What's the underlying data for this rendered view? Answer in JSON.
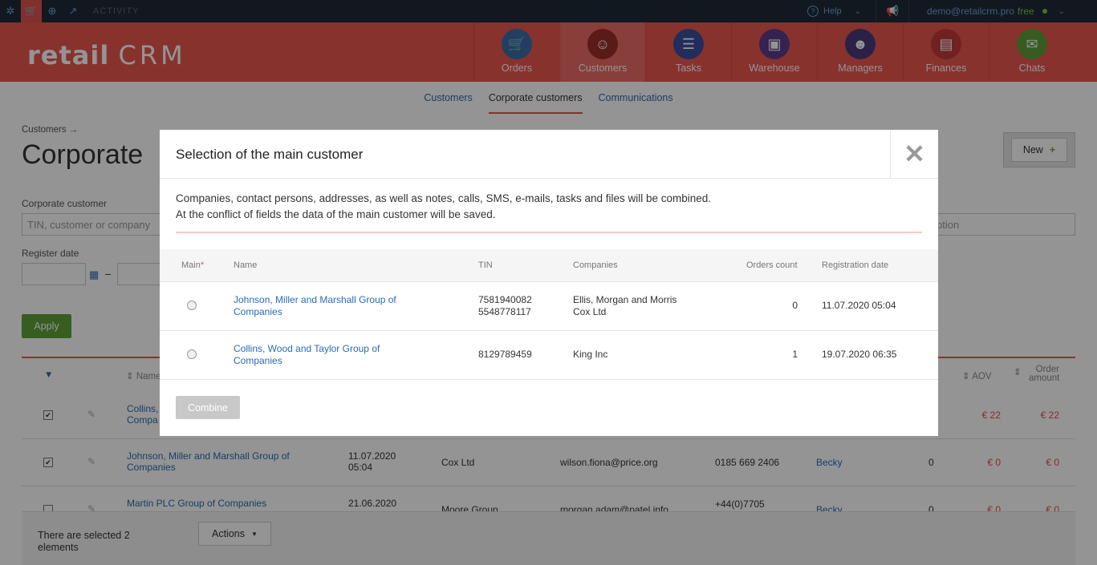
{
  "topbar": {
    "activity": "ACTIVITY",
    "help": "Help",
    "user_email": "demo@retailcrm.pro",
    "plan": "free"
  },
  "header": {
    "logo_text": "retail",
    "logo_text_2": "CRM",
    "nav": [
      {
        "label": "Orders",
        "icon": "cart-icon",
        "color": "#3a6fa8"
      },
      {
        "label": "Customers",
        "icon": "person-icon",
        "color": "#9c2f2a"
      },
      {
        "label": "Tasks",
        "icon": "list-icon",
        "color": "#3b4f9e"
      },
      {
        "label": "Warehouse",
        "icon": "box-icon",
        "color": "#5d3c8a"
      },
      {
        "label": "Managers",
        "icon": "manager-icon",
        "color": "#4a3a7a"
      },
      {
        "label": "Finances",
        "icon": "receipt-icon",
        "color": "#c23c3c"
      },
      {
        "label": "Chats",
        "icon": "chat-icon",
        "color": "#5f9f3a"
      }
    ]
  },
  "subnav": {
    "items": [
      "Customers",
      "Corporate customers",
      "Communications"
    ],
    "active": "Corporate customers"
  },
  "page": {
    "breadcrumb": "Customers →",
    "title": "Corporate",
    "new_button": "New",
    "filter_label_1": "Corporate customer",
    "filter_placeholder_1": "TIN, customer or company",
    "filter_label_2": "Register date",
    "filter_right_placeholder": "ption",
    "date_dash": "–",
    "apply": "Apply"
  },
  "table": {
    "headers": {
      "name": "Name",
      "aov": "AOV",
      "order_amount_1": "Order",
      "order_amount_2": "amount"
    },
    "rows": [
      {
        "name_1": "Collins,",
        "name_2": "Compa",
        "date_1": "",
        "date_2": "",
        "company": "",
        "email": "",
        "phone": "",
        "manager": "",
        "count": "",
        "aov": "€ 22",
        "amount": "€ 22",
        "checked": true
      },
      {
        "name_1": "Johnson, Miller and Marshall Group of",
        "name_2": "Companies",
        "date_1": "11.07.2020",
        "date_2": "05:04",
        "company": "Cox Ltd",
        "email": "wilson.fiona@price.org",
        "phone": "0185 669 2406",
        "manager": "Becky",
        "count": "0",
        "aov": "€ 0",
        "amount": "€ 0",
        "checked": true
      },
      {
        "name_1": "Martin PLC Group of Companies",
        "name_2": "",
        "date_1": "21.06.2020",
        "date_2": "",
        "company": "Moore Group",
        "email": "morgan.adam@patel.info",
        "phone": "+44(0)7705",
        "manager": "Becky",
        "count": "0",
        "aov": "€ 0",
        "amount": "€ 0",
        "checked": false
      }
    ]
  },
  "bottom": {
    "selected_text": "There are selected 2 elements",
    "actions": "Actions"
  },
  "modal": {
    "title": "Selection of the main customer",
    "desc_1": "Companies, contact persons, addresses, as well as notes, calls, SMS, e-mails, tasks and files will be combined.",
    "desc_2": "At the conflict of fields the data of the main customer will be saved.",
    "columns": {
      "main": "Main",
      "required": "*",
      "name": "Name",
      "tin": "TIN",
      "companies": "Companies",
      "orders": "Orders count",
      "reg": "Registration date"
    },
    "rows": [
      {
        "name_1": "Johnson, Miller and Marshall Group of",
        "name_2": "Companies",
        "tin_1": "7581940082",
        "tin_2": "5548778117",
        "comp_1": "Ellis, Morgan and Morris",
        "comp_2": "Cox Ltd",
        "orders": "0",
        "reg": "11.07.2020 05:04"
      },
      {
        "name_1": "Collins, Wood and Taylor Group of",
        "name_2": "Companies",
        "tin_1": "8129789459",
        "tin_2": "",
        "comp_1": "King Inc",
        "comp_2": "",
        "orders": "1",
        "reg": "19.07.2020 06:35"
      }
    ],
    "combine": "Combine"
  }
}
